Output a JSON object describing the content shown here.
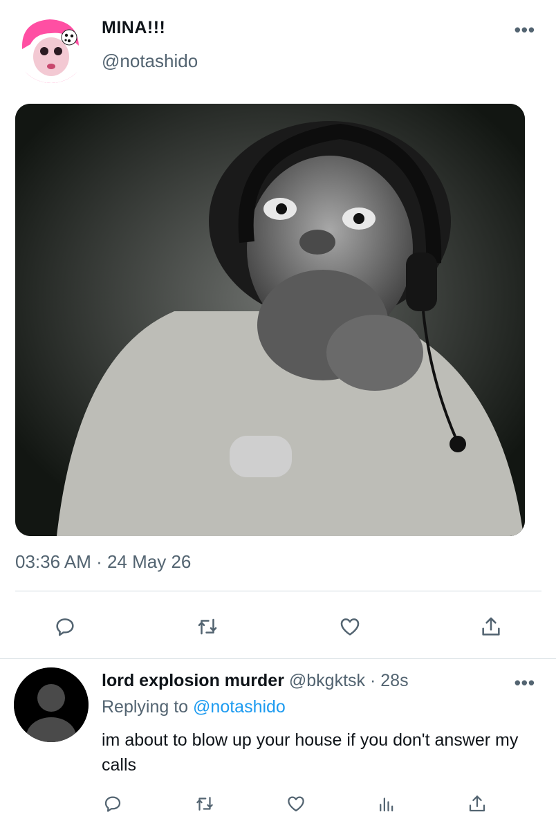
{
  "main_tweet": {
    "display_name": "MINA!!!",
    "handle": "@notashido",
    "more_label": "•••",
    "timestamp": "03:36 AM · 24 May 26",
    "actions": [
      "reply-icon",
      "retweet-icon",
      "like-icon",
      "share-icon"
    ]
  },
  "reply": {
    "display_name": "lord explosion murder",
    "handle": "@bkgktsk",
    "separator": "·",
    "time": "28s",
    "more_label": "•••",
    "replying_prefix": "Replying to",
    "replying_handle": "@notashido",
    "text": "im about to blow up your house if you don't answer my calls",
    "actions": [
      "reply-icon",
      "retweet-icon",
      "like-icon",
      "analytics-icon",
      "share-icon"
    ]
  },
  "colors": {
    "text_primary": "#0f1419",
    "text_secondary": "#536471",
    "link": "#1d9bf0",
    "divider": "#cfd9de"
  }
}
